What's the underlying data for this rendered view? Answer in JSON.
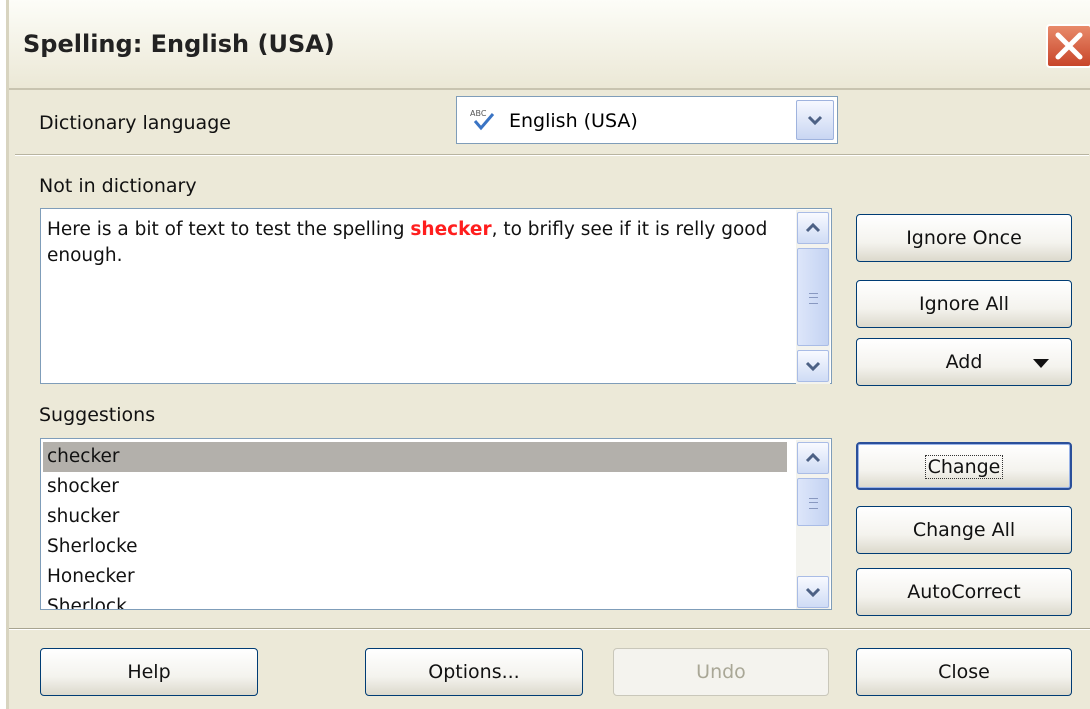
{
  "window": {
    "title": "Spelling: English (USA)"
  },
  "dictionary": {
    "label": "Dictionary language",
    "value": "English (USA)",
    "icon": "spellcheck-abc-icon"
  },
  "not_in_dictionary": {
    "label": "Not in dictionary",
    "text_before": "Here is a bit of text to test the spelling ",
    "error_word": "shecker",
    "text_after": ", to brifly see if it is relly good enough.",
    "error_color": "#ff1e1e"
  },
  "suggestions": {
    "label": "Suggestions",
    "items": [
      "checker",
      "shocker",
      "shucker",
      "Sherlocke",
      "Honecker",
      "Sherlock"
    ],
    "selected": "checker"
  },
  "side_buttons": {
    "ignore_once": "Ignore Once",
    "ignore_all": "Ignore All",
    "add": "Add",
    "change": "Change",
    "change_all": "Change All",
    "autocorrect": "AutoCorrect"
  },
  "bottom_buttons": {
    "help": "Help",
    "options": "Options...",
    "undo": "Undo",
    "close": "Close"
  }
}
